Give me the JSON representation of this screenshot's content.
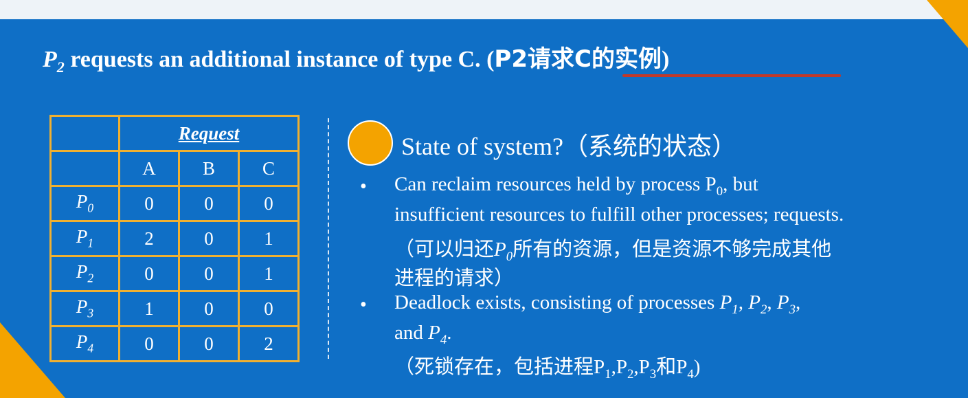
{
  "title": {
    "text": "requests an additional instance of type C. (",
    "cn": "P2请求C的实例",
    "close": ")"
  },
  "table": {
    "header": "Request",
    "columns": [
      "A",
      "B",
      "C"
    ],
    "rows": [
      {
        "proc": "P",
        "sub": "0",
        "values": [
          "0",
          "0",
          "0"
        ]
      },
      {
        "proc": "P",
        "sub": "1",
        "values": [
          "2",
          "0",
          "1"
        ]
      },
      {
        "proc": "P",
        "sub": "2",
        "values": [
          "0",
          "0",
          "1"
        ]
      },
      {
        "proc": "P",
        "sub": "3",
        "values": [
          "1",
          "0",
          "0"
        ]
      },
      {
        "proc": "P",
        "sub": "4",
        "values": [
          "0",
          "0",
          "2"
        ]
      }
    ]
  },
  "state": {
    "en": "State of system?",
    "cn": "（系统的状态）"
  },
  "bullet1": {
    "line1": "Can reclaim resources held by process P",
    "line1_sub": "0",
    "line1_end": ", but",
    "line2": "insufficient resources to fulfill other processes; requests.",
    "cn1_a": "（可以归还",
    "cn1_b": "所有的资源，但是资源不够完成其他",
    "cn2": "进程的请求）"
  },
  "bullet2": {
    "line1": "Deadlock exists, consisting of processes",
    "line2": "and",
    "cn_a": "（死锁存在，包括进程",
    "cn_and": "和"
  },
  "bullet_symbol": "•"
}
